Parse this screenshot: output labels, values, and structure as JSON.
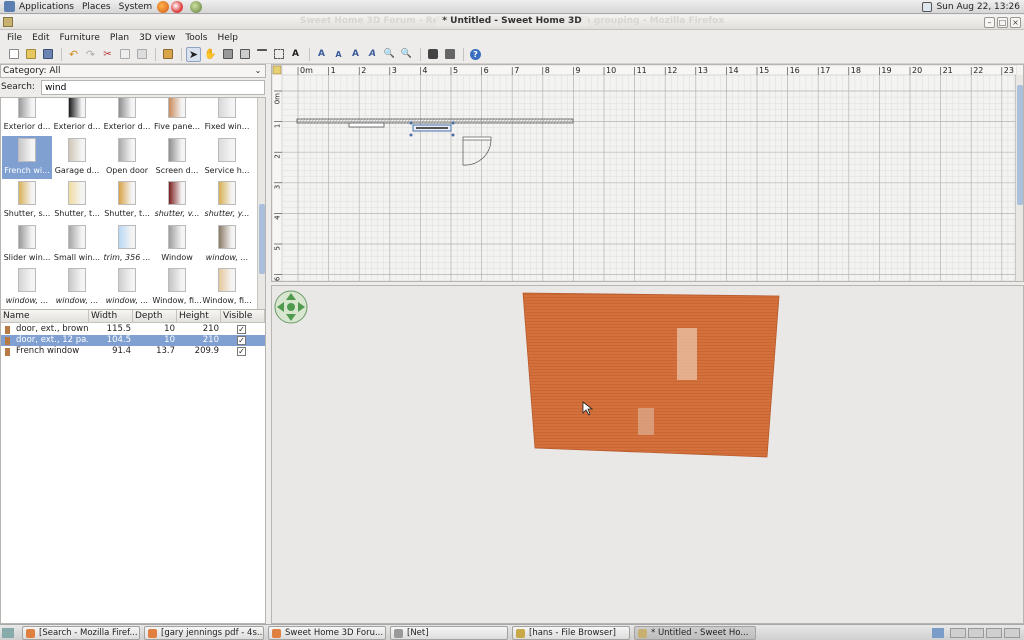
{
  "top_panel": {
    "menus": [
      "Applications",
      "Places",
      "System"
    ],
    "clock": "Sun Aug 22, 13:26"
  },
  "window": {
    "background_title": "Sweet Home 3D Forum - Reply to the ... - It's not ... when grouping - Mozilla Firefox",
    "title": "* Untitled - Sweet Home 3D"
  },
  "menubar": [
    "File",
    "Edit",
    "Furniture",
    "Plan",
    "3D view",
    "Tools",
    "Help"
  ],
  "catalog": {
    "category_label": "Category:",
    "category_value": "All",
    "search_label": "Search:",
    "search_value": "wind",
    "items": [
      {
        "label": "Exterior d...",
        "italic": false,
        "color": "#9a9a9a"
      },
      {
        "label": "Exterior d...",
        "italic": false,
        "color": "#1a1a1a"
      },
      {
        "label": "Exterior d...",
        "italic": false,
        "color": "#8e8e8e"
      },
      {
        "label": "Five pane...",
        "italic": false,
        "color": "#c98a5a"
      },
      {
        "label": "Fixed win...",
        "italic": false,
        "color": "#d8d8d8"
      },
      {
        "label": "French wi...",
        "italic": false,
        "color": "#c7c7c7",
        "selected": true
      },
      {
        "label": "Garage d...",
        "italic": false,
        "color": "#cfc6b8"
      },
      {
        "label": "Open door",
        "italic": false,
        "color": "#a9a9a9"
      },
      {
        "label": "Screen d...",
        "italic": false,
        "color": "#8f8f8f"
      },
      {
        "label": "Service h...",
        "italic": false,
        "color": "#dcdcdc"
      },
      {
        "label": "Shutter, s...",
        "italic": false,
        "color": "#d9b25a"
      },
      {
        "label": "Shutter, t...",
        "italic": false,
        "color": "#f0dca0"
      },
      {
        "label": "Shutter, t...",
        "italic": false,
        "color": "#d9a44a"
      },
      {
        "label": "shutter, v...",
        "italic": true,
        "color": "#7a1f1f"
      },
      {
        "label": "shutter, y...",
        "italic": true,
        "color": "#d7b050"
      },
      {
        "label": "Slider win...",
        "italic": false,
        "color": "#9a9a9a"
      },
      {
        "label": "Small win...",
        "italic": false,
        "color": "#a6a6a6"
      },
      {
        "label": "trim, 356 ...",
        "italic": true,
        "color": "#b9d8f5"
      },
      {
        "label": "Window",
        "italic": false,
        "color": "#9d9d9d"
      },
      {
        "label": "window, ...",
        "italic": true,
        "color": "#8a7a66"
      },
      {
        "label": "window, ...",
        "italic": true,
        "color": "#d4d4d4"
      },
      {
        "label": "window, ...",
        "italic": true,
        "color": "#c8c8c8"
      },
      {
        "label": "window, ...",
        "italic": true,
        "color": "#cfcfcf"
      },
      {
        "label": "Window, fi...",
        "italic": false,
        "color": "#c4c4c4"
      },
      {
        "label": "Window, fi...",
        "italic": false,
        "color": "#e6c89c"
      }
    ]
  },
  "furniture_table": {
    "columns": [
      "Name",
      "Width",
      "Depth",
      "Height",
      "Visible"
    ],
    "rows": [
      {
        "name": "door, ext., brown",
        "width": "115.5",
        "depth": "10",
        "height": "210",
        "visible": true,
        "selected": false
      },
      {
        "name": "door, ext., 12 pa...",
        "width": "104.5",
        "depth": "10",
        "height": "210",
        "visible": true,
        "selected": true
      },
      {
        "name": "French window",
        "width": "91.4",
        "depth": "13.7",
        "height": "209.9",
        "visible": true,
        "selected": false
      }
    ]
  },
  "plan": {
    "ruler_x": [
      "0m",
      "1",
      "2",
      "3",
      "4",
      "5",
      "6",
      "7",
      "8",
      "9",
      "10",
      "11",
      "12",
      "13",
      "14",
      "15",
      "16",
      "17",
      "18",
      "19",
      "20",
      "21",
      "22",
      "23"
    ],
    "ruler_y": [
      "0m",
      "1",
      "2",
      "3",
      "4",
      "5",
      "6"
    ]
  },
  "view3d": {
    "wall_color": "#d4703c"
  },
  "taskbar": {
    "tasks": [
      {
        "label": "[Search - Mozilla Firef...",
        "active": false
      },
      {
        "label": "[gary jennings pdf - 4s...",
        "active": false
      },
      {
        "label": "Sweet Home 3D Foru...",
        "active": false
      },
      {
        "label": "[Net]",
        "active": false
      },
      {
        "label": "[hans - File Browser]",
        "active": false
      },
      {
        "label": "* Untitled - Sweet Ho...",
        "active": true
      }
    ]
  }
}
